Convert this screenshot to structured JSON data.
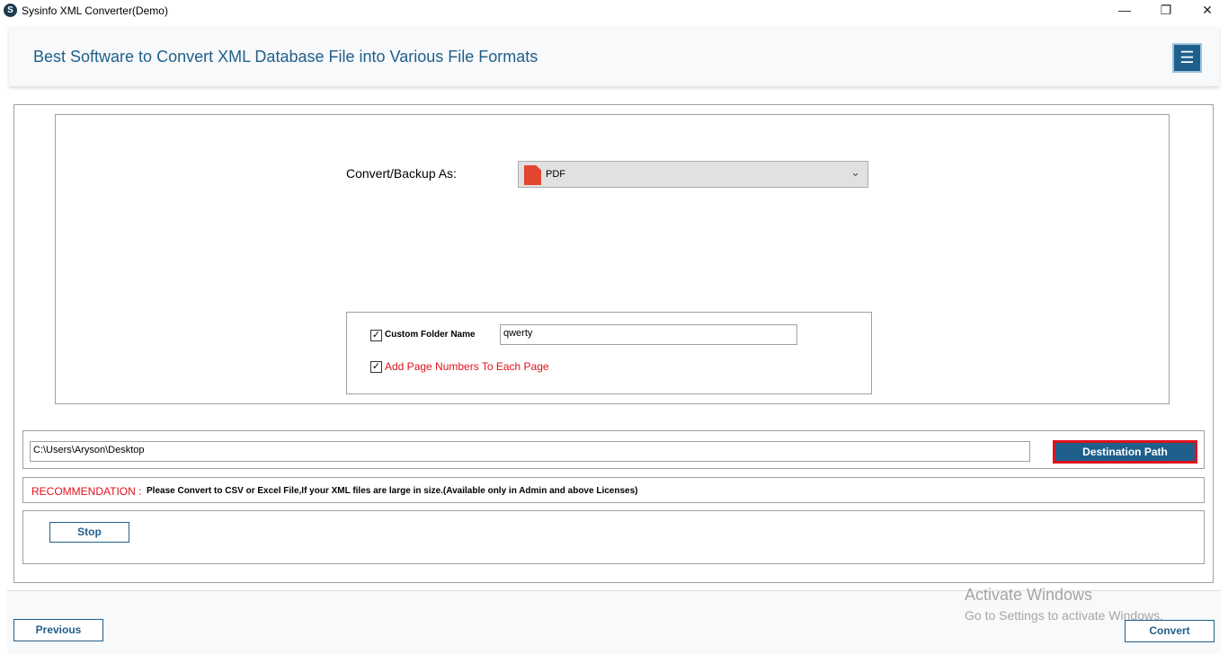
{
  "window": {
    "title": "Sysinfo XML Converter(Demo)",
    "minimize": "—",
    "maximize": "❐",
    "close": "✕"
  },
  "header": {
    "title": "Best Software to Convert XML Database File into Various File Formats",
    "menu_icon": "☰"
  },
  "convert": {
    "label": "Convert/Backup As:",
    "selected": "PDF",
    "chevron": "⌄"
  },
  "options": {
    "custom_folder_label": "Custom Folder Name",
    "custom_folder_value": "qwerty",
    "custom_folder_checked": true,
    "page_numbers_label": "Add Page Numbers To Each Page",
    "page_numbers_checked": true,
    "check": "✓"
  },
  "destination": {
    "path": "C:\\Users\\Aryson\\Desktop",
    "button": "Destination Path"
  },
  "recommendation": {
    "label": "RECOMMENDATION :",
    "text": "Please Convert to CSV or Excel File,If your XML files are large in size.(Available only in Admin and above Licenses)"
  },
  "actions": {
    "stop": "Stop",
    "previous": "Previous",
    "convert": "Convert"
  },
  "watermark": {
    "title": "Activate Windows",
    "subtitle": "Go to Settings to activate Windows."
  }
}
